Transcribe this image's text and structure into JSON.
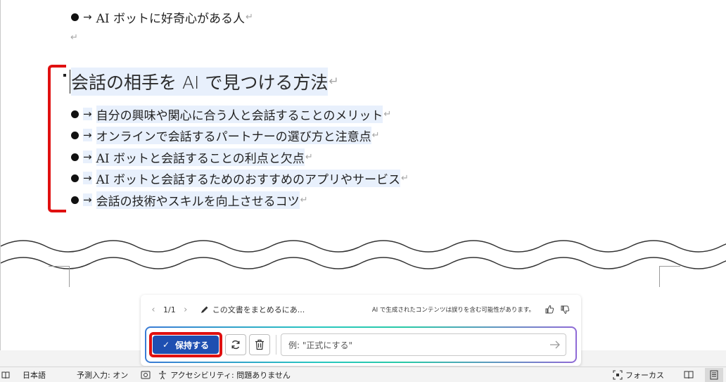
{
  "document": {
    "top_bullet": "AI ボットに好奇心がある人",
    "heading": "会話の相手を AI で見つける方法",
    "bullets": [
      "自分の興味や関心に合う人と会話することのメリット",
      "オンラインで会話するパートナーの選び方と注意点",
      "AI ボットと会話することの利点と欠点",
      "AI ボットと会話するためのおすすめのアプリやサービス",
      "会話の技術やスキルを向上させるコツ"
    ],
    "arrow": "→",
    "para_mark": "↵"
  },
  "copilot": {
    "counter": "1/1",
    "task_label": "この文書をまとめるにあ...",
    "disclaimer": "AI で生成されたコンテンツは誤りを含む可能性があります。",
    "keep_label": "保持する",
    "prompt_placeholder": "例: \"正式にする\""
  },
  "statusbar": {
    "language": "日本語",
    "predictive_input": "予測入力: オン",
    "accessibility": "アクセシビリティ: 問題ありません",
    "focus": "フォーカス"
  },
  "colors": {
    "highlight": "#e8f0fc",
    "keep_button": "#1e4fb1",
    "annotation_red": "#e01010"
  }
}
